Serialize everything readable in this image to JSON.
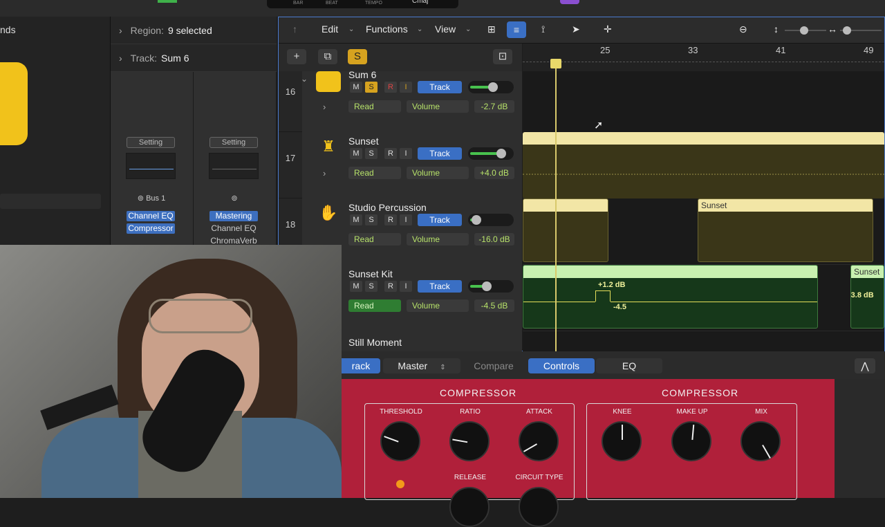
{
  "lcd": {
    "bar": "BAR",
    "beat": "BEAT",
    "tempo": "TEMPO",
    "key": "Cmaj"
  },
  "left_panel": {
    "label": "nds"
  },
  "inspector": {
    "region_label": "Region:",
    "region_value": "9 selected",
    "track_label": "Track:",
    "track_value": "Sum 6",
    "strip1": {
      "setting": "Setting",
      "bus": "Bus 1",
      "plugins": [
        "Channel EQ",
        "Compressor"
      ]
    },
    "strip2": {
      "setting": "Setting",
      "plugins": [
        "Mastering",
        "Channel EQ",
        "ChromaVerb"
      ]
    }
  },
  "toolbar": {
    "edit": "Edit",
    "functions": "Functions",
    "view": "View"
  },
  "track_header": {
    "solo": "S"
  },
  "tracks": [
    {
      "num": "16",
      "name": "Sum 6",
      "m": "M",
      "s": "S",
      "r": "R",
      "i": "I",
      "track_btn": "Track",
      "read": "Read",
      "param": "Volume",
      "db": "-2.7 dB",
      "fader": 0.6
    },
    {
      "num": "17",
      "name": "Sunset",
      "m": "M",
      "s": "S",
      "r": "R",
      "i": "I",
      "track_btn": "Track",
      "read": "Read",
      "param": "Volume",
      "db": "+4.0 dB",
      "fader": 0.8
    },
    {
      "num": "18",
      "name": "Studio Percussion",
      "m": "M",
      "s": "S",
      "r": "R",
      "i": "I",
      "track_btn": "Track",
      "read": "Read",
      "param": "Volume",
      "db": "-16.0 dB",
      "fader": 0.2
    },
    {
      "num": "",
      "name": "Sunset Kit",
      "m": "M",
      "s": "S",
      "r": "R",
      "i": "I",
      "track_btn": "Track",
      "read": "Read",
      "param": "Volume",
      "db": "-4.5 dB",
      "fader": 0.45
    },
    {
      "num": "",
      "name": "Still Moment"
    }
  ],
  "ruler": {
    "bars": [
      "25",
      "33",
      "41",
      "49"
    ]
  },
  "regions": {
    "sunset1": "Sunset",
    "sunset2": "Sunset",
    "auto_high": "+1.2 dB",
    "auto_low": "-4.5",
    "auto_end": "-3.8 dB"
  },
  "plugin_bar": {
    "track": "rack",
    "master": "Master",
    "compare": "Compare",
    "controls": "Controls",
    "eq": "EQ"
  },
  "plugin": {
    "title_left": "COMPRESSOR",
    "title_right": "COMPRESSOR",
    "threshold": "THRESHOLD",
    "ratio": "RATIO",
    "attack": "ATTACK",
    "knee": "KNEE",
    "makeup": "MAKE UP",
    "mix": "MIX",
    "release": "RELEASE",
    "circuit": "CIRCUIT TYPE"
  },
  "colors": {
    "accent": "#3a6fc4",
    "region_yellow": "#f2e6a6",
    "region_green": "#c8f0b0",
    "plugin_red": "#b0203a"
  }
}
